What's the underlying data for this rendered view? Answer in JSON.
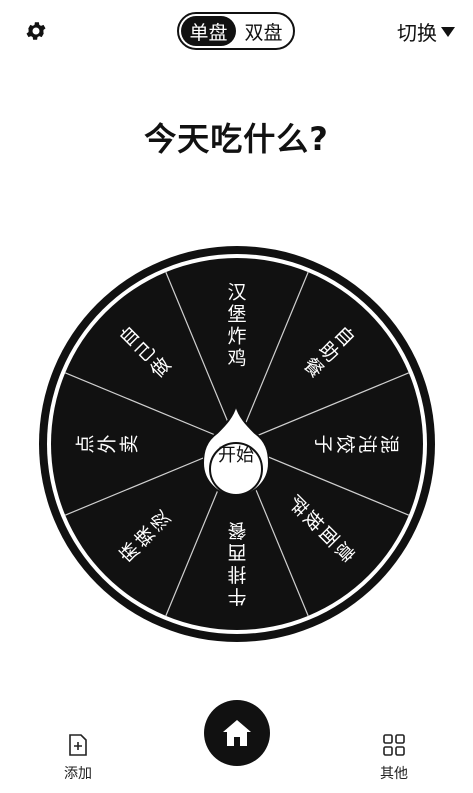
{
  "header": {
    "settings_icon": "gear-icon",
    "mode_single": "单盘",
    "mode_double": "双盘",
    "switch_label": "切换"
  },
  "title": "今天吃什么?",
  "wheel": {
    "slices": [
      "汉堡炸鸡",
      "自助餐",
      "混沌饺子",
      "意面披萨",
      "牛排西餐",
      "麻辣烫",
      "点外卖",
      "自己做"
    ],
    "start_label": "开始"
  },
  "bottom": {
    "add_label": "添加",
    "other_label": "其他",
    "home_icon": "home-icon"
  }
}
